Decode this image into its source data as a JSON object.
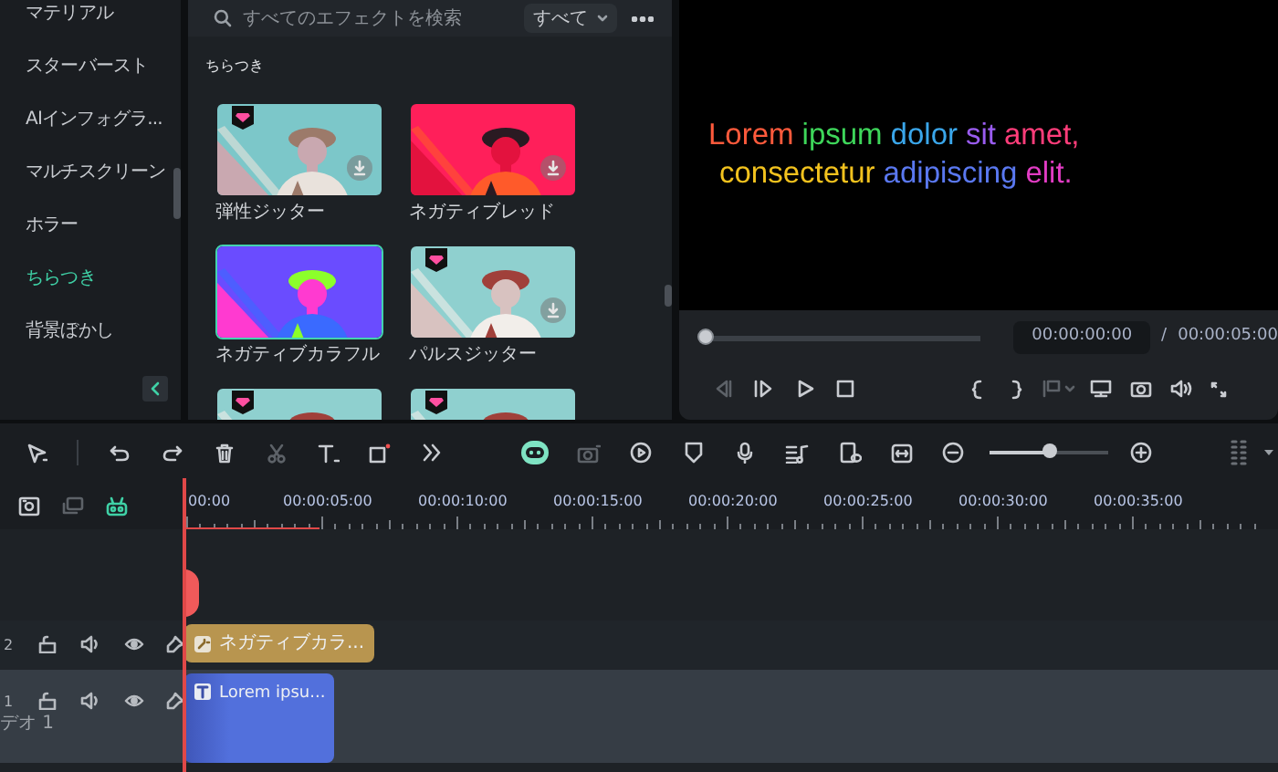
{
  "sidebar": {
    "items": [
      {
        "label": "マテリアル",
        "selected": false
      },
      {
        "label": "スターバースト",
        "selected": false
      },
      {
        "label": "AIインフォグラ...",
        "selected": false
      },
      {
        "label": "マルチスクリーン",
        "selected": false
      },
      {
        "label": "ホラー",
        "selected": false
      },
      {
        "label": "ちらつき",
        "selected": true
      },
      {
        "label": "背景ぼかし",
        "selected": false
      }
    ]
  },
  "effects": {
    "search": {
      "placeholder": "すべてのエフェクトを検索"
    },
    "filter": {
      "value": "すべて"
    },
    "section": "ちらつき",
    "cards": [
      {
        "label": "弾性ジッター",
        "premium": true,
        "download": true,
        "selected": false
      },
      {
        "label": "ネガティブレッド",
        "premium": false,
        "download": true,
        "selected": false
      },
      {
        "label": "ネガティブカラフル",
        "premium": false,
        "download": false,
        "selected": true
      },
      {
        "label": "パルスジッター",
        "premium": true,
        "download": true,
        "selected": false
      },
      {
        "premium": true,
        "download": false,
        "selected": false
      },
      {
        "premium": true,
        "download": false,
        "selected": false
      }
    ]
  },
  "preview": {
    "caption_lines": [
      [
        {
          "text": "Lorem",
          "color": "#ff5a3c"
        },
        {
          "text": "ipsum",
          "color": "#3ed65a"
        },
        {
          "text": "dolor",
          "color": "#3aa6ea"
        },
        {
          "text": "sit",
          "color": "#9a5cf0"
        },
        {
          "text": "amet,",
          "color": "#ff3d7a"
        }
      ],
      [
        {
          "text": "consectetur",
          "color": "#f2c21e"
        },
        {
          "text": "adipiscing",
          "color": "#5a78f0"
        },
        {
          "text": "elit.",
          "color": "#e23cc4"
        }
      ]
    ],
    "progress": {
      "level": 0
    },
    "current_time": "00:00:00:00",
    "separator": "/",
    "total_time": "00:00:05:00"
  },
  "toolbar": {
    "zoom": {
      "level": 0.5
    }
  },
  "timeline": {
    "ruler": [
      "00:00",
      "00:00:05:00",
      "00:00:10:00",
      "00:00:15:00",
      "00:00:20:00",
      "00:00:25:00",
      "00:00:30:00",
      "00:00:35:00"
    ],
    "tracks": [
      {
        "number": "2",
        "clips": [
          {
            "kind": "effect",
            "label": "ネガティブカラ..."
          }
        ]
      },
      {
        "number": "1",
        "name": "デオ 1",
        "clips": [
          {
            "kind": "text",
            "label": "Lorem ipsu..."
          }
        ]
      }
    ]
  }
}
